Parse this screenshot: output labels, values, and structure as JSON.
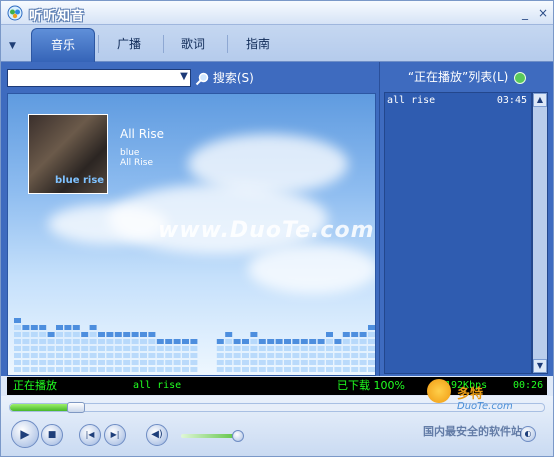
{
  "window": {
    "title": "听听知音"
  },
  "tabs": [
    "音乐",
    "广播",
    "歌词",
    "指南"
  ],
  "active_tab": 0,
  "search": {
    "value": "",
    "button_label": "搜索(S)"
  },
  "now_playing": {
    "title": "All Rise",
    "artist": "blue",
    "album": "All Rise",
    "cover_text": "blue rise"
  },
  "watermark": "www.DuoTe.com",
  "spectrum_levels": [
    0.8,
    0.72,
    0.68,
    0.7,
    0.62,
    0.7,
    0.72,
    0.66,
    0.64,
    0.7,
    0.62,
    0.6,
    0.64,
    0.62,
    0.56,
    0.6,
    0.55,
    0.52,
    0.5,
    0.52,
    0.48,
    0.46,
    0.52,
    0.58,
    0.52,
    0.5,
    0.56,
    0.5,
    0.52,
    0.5,
    0.5,
    0.48,
    0.5,
    0.52,
    0.5,
    0.56,
    0.52,
    0.6,
    0.58,
    0.62,
    0.66,
    0.68,
    0.72,
    0.8
  ],
  "playlist": {
    "header": "“正在播放”列表(L)",
    "items": [
      {
        "title": "all rise",
        "duration": "03:45"
      }
    ]
  },
  "status": {
    "state": "正在播放",
    "track": "all rise",
    "download": "已下载 100%",
    "bitrate": "192Kbps",
    "time": "00:26"
  },
  "progress": 0.11,
  "volume": 0.95,
  "branding": {
    "tag1": "多特",
    "tag2": "DuoTe.com",
    "tag3": "国内最安全的软件站"
  }
}
